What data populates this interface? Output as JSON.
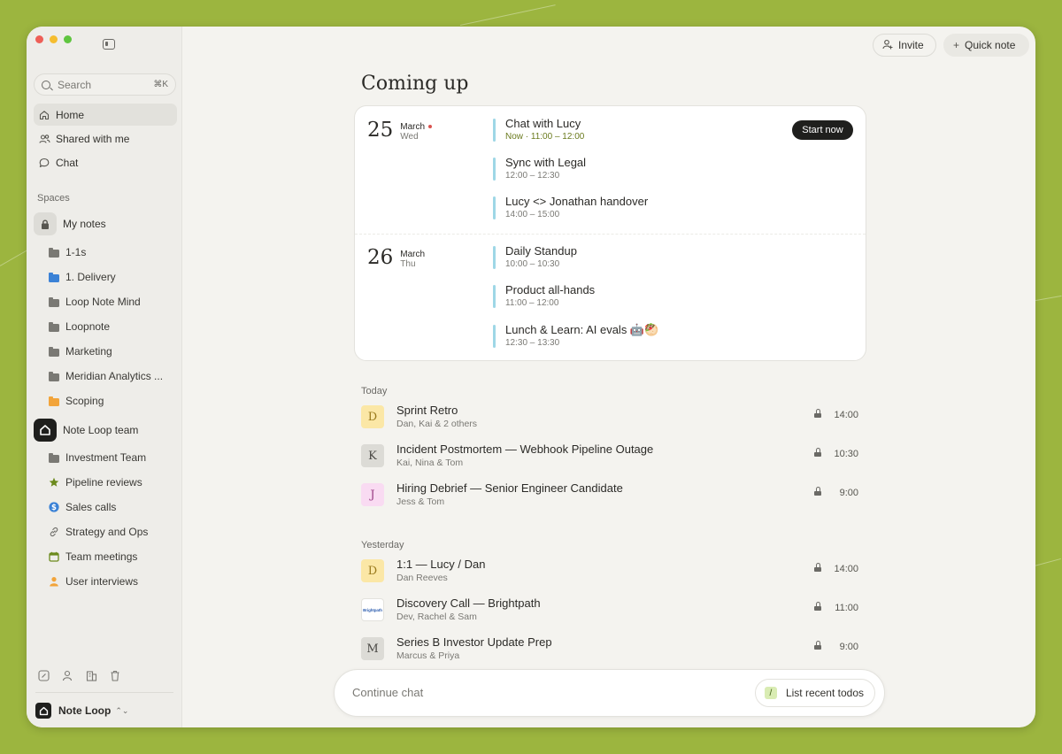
{
  "sidebar": {
    "search": {
      "label": "Search",
      "shortcut": "⌘K"
    },
    "nav": [
      {
        "label": "Home",
        "icon": "home-icon",
        "active": true
      },
      {
        "label": "Shared with me",
        "icon": "people-icon"
      },
      {
        "label": "Chat",
        "icon": "chat-bubble-icon"
      }
    ],
    "spaces_label": "Spaces",
    "my_notes": {
      "label": "My notes",
      "items": [
        {
          "label": "1-1s",
          "icon": "folder-icon",
          "color": "#7a7974"
        },
        {
          "label": "1. Delivery",
          "icon": "folder-icon",
          "color": "#3b82d6"
        },
        {
          "label": "Loop Note Mind",
          "icon": "folder-icon",
          "color": "#7a7974"
        },
        {
          "label": "Loopnote",
          "icon": "folder-icon",
          "color": "#7a7974"
        },
        {
          "label": "Marketing",
          "icon": "folder-icon",
          "color": "#7a7974"
        },
        {
          "label": "Meridian Analytics ...",
          "icon": "folder-icon",
          "color": "#7a7974"
        },
        {
          "label": "Scoping",
          "icon": "folder-icon",
          "color": "#f2a43a"
        }
      ]
    },
    "team": {
      "label": "Note Loop team",
      "items": [
        {
          "label": "Investment Team",
          "icon": "folder-icon"
        },
        {
          "label": "Pipeline reviews",
          "icon": "star-icon"
        },
        {
          "label": "Sales calls",
          "icon": "dollar-icon"
        },
        {
          "label": "Strategy and Ops",
          "icon": "link-icon"
        },
        {
          "label": "Team meetings",
          "icon": "calendar-icon"
        },
        {
          "label": "User interviews",
          "icon": "person-icon"
        }
      ]
    },
    "workspace": {
      "name": "Note Loop"
    }
  },
  "header": {
    "invite_label": "Invite",
    "quick_note_label": "Quick note"
  },
  "main": {
    "heading": "Coming up",
    "days": [
      {
        "day": "25",
        "month": "March",
        "weekday": "Wed",
        "has_dot": true,
        "events": [
          {
            "title": "Chat with Lucy",
            "time": "Now · 11:00 – 12:00",
            "now": true
          },
          {
            "title": "Sync with Legal",
            "time": "12:00 – 12:30"
          },
          {
            "title": "Lucy <> Jonathan handover",
            "time": "14:00 – 15:00"
          }
        ]
      },
      {
        "day": "26",
        "month": "March",
        "weekday": "Thu",
        "events": [
          {
            "title": "Daily Standup",
            "time": "10:00 – 10:30"
          },
          {
            "title": "Product all-hands",
            "time": "11:00 – 12:00"
          },
          {
            "title": "Lunch & Learn: AI evals 🤖🥙",
            "time": "12:30 – 13:30"
          }
        ]
      }
    ],
    "start_now_label": "Start now",
    "today_label": "Today",
    "today": [
      {
        "initial": "D",
        "title": "Sprint Retro",
        "people": "Dan, Kai & 2 others",
        "time": "14:00",
        "bg": "#fbe7a6",
        "fg": "#9a7a1c"
      },
      {
        "initial": "K",
        "title": "Incident Postmortem — Webhook Pipeline Outage",
        "people": "Kai, Nina & Tom",
        "time": "10:30",
        "bg": "#dcdbd6",
        "fg": "#4a4945"
      },
      {
        "initial": "J",
        "title": "Hiring Debrief — Senior Engineer Candidate",
        "people": "Jess & Tom",
        "time": "9:00",
        "bg": "#f9dbf2",
        "fg": "#9a3f85"
      }
    ],
    "yesterday_label": "Yesterday",
    "yesterday": [
      {
        "initial": "D",
        "title": "1:1 — Lucy / Dan",
        "people": "Dan Reeves",
        "time": "14:00",
        "bg": "#fbe7a6",
        "fg": "#9a7a1c"
      },
      {
        "initial": "Brightpath",
        "title": "Discovery Call — Brightpath",
        "people": "Dev, Rachel & Sam",
        "time": "11:00",
        "bg": "#ffffff",
        "fg": "#2f5fb0",
        "logo": true
      },
      {
        "initial": "M",
        "title": "Series B Investor Update Prep",
        "people": "Marcus & Priya",
        "time": "9:00",
        "bg": "#dcdbd6",
        "fg": "#4a4945"
      }
    ]
  },
  "chat": {
    "placeholder": "Continue chat",
    "shortcut_key": "/",
    "suggestion": "List recent todos"
  }
}
